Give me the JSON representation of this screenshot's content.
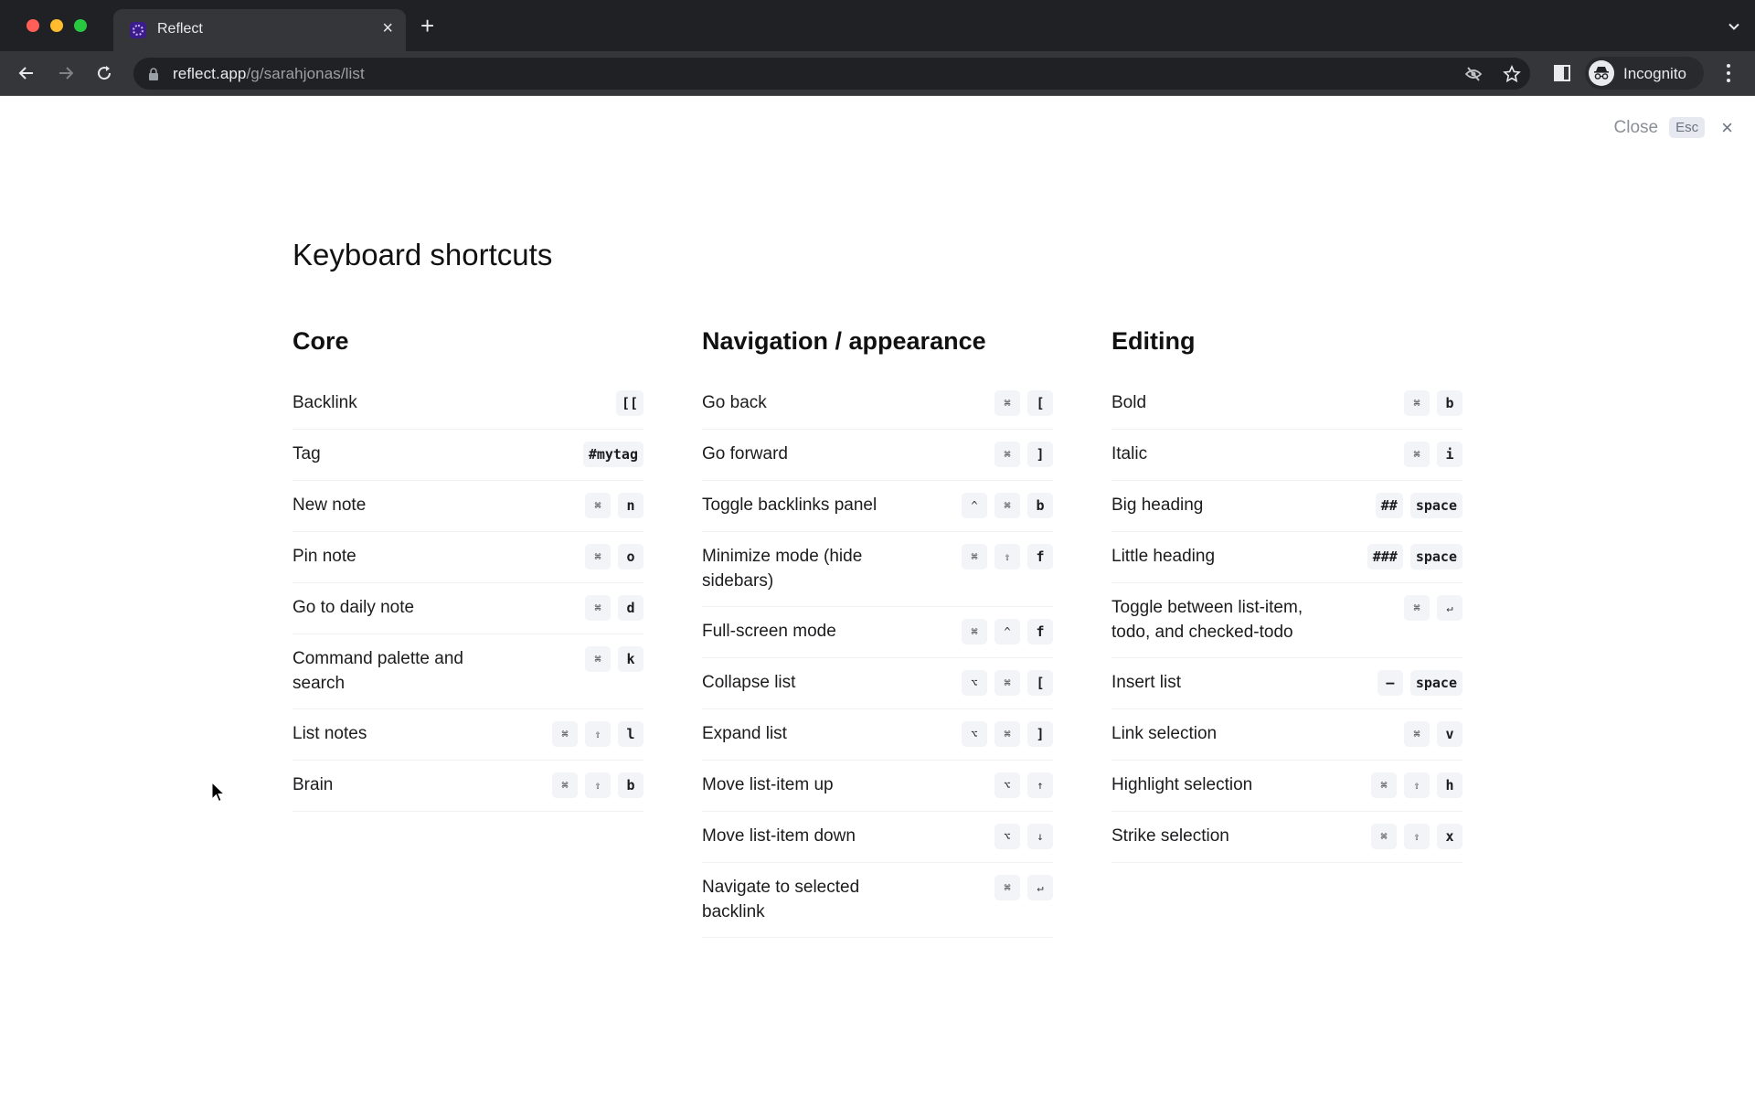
{
  "browser": {
    "tab_title": "Reflect",
    "url_host": "reflect.app",
    "url_path": "/g/sarahjonas/list",
    "profile_label": "Incognito",
    "icons": {
      "back": "arrow-left-icon",
      "forward": "arrow-right-icon",
      "reload": "reload-icon",
      "lock": "lock-icon",
      "tracking": "eye-slash-icon",
      "bookmark": "star-icon",
      "side_panel": "side-panel-icon",
      "incognito": "incognito-icon",
      "menu": "kebab-menu-icon",
      "tab_search": "chevron-down-icon"
    }
  },
  "modal": {
    "close_label": "Close",
    "close_key": "Esc",
    "close_icon": "×",
    "title": "Keyboard shortcuts"
  },
  "sections": [
    {
      "title": "Core",
      "items": [
        {
          "label": "Backlink",
          "keys": [
            "[["
          ]
        },
        {
          "label": "Tag",
          "keys": [
            "#mytag"
          ]
        },
        {
          "label": "New note",
          "keys": [
            "⌘",
            "n"
          ]
        },
        {
          "label": "Pin note",
          "keys": [
            "⌘",
            "o"
          ]
        },
        {
          "label": "Go to daily note",
          "keys": [
            "⌘",
            "d"
          ]
        },
        {
          "label": "Command palette and search",
          "keys": [
            "⌘",
            "k"
          ]
        },
        {
          "label": "List notes",
          "keys": [
            "⌘",
            "⇧",
            "l"
          ]
        },
        {
          "label": "Brain",
          "keys": [
            "⌘",
            "⇧",
            "b"
          ]
        }
      ]
    },
    {
      "title": "Navigation / appearance",
      "items": [
        {
          "label": "Go back",
          "keys": [
            "⌘",
            "["
          ]
        },
        {
          "label": "Go forward",
          "keys": [
            "⌘",
            "]"
          ]
        },
        {
          "label": "Toggle backlinks panel",
          "keys": [
            "^",
            "⌘",
            "b"
          ]
        },
        {
          "label": "Minimize mode (hide sidebars)",
          "keys": [
            "⌘",
            "⇧",
            "f"
          ]
        },
        {
          "label": "Full-screen mode",
          "keys": [
            "⌘",
            "^",
            "f"
          ]
        },
        {
          "label": "Collapse list",
          "keys": [
            "⌥",
            "⌘",
            "["
          ]
        },
        {
          "label": "Expand list",
          "keys": [
            "⌥",
            "⌘",
            "]"
          ]
        },
        {
          "label": "Move list-item up",
          "keys": [
            "⌥",
            "↑"
          ]
        },
        {
          "label": "Move list-item down",
          "keys": [
            "⌥",
            "↓"
          ]
        },
        {
          "label": "Navigate to selected backlink",
          "keys": [
            "⌘",
            "↵"
          ]
        }
      ]
    },
    {
      "title": "Editing",
      "items": [
        {
          "label": "Bold",
          "keys": [
            "⌘",
            "b"
          ]
        },
        {
          "label": "Italic",
          "keys": [
            "⌘",
            "i"
          ]
        },
        {
          "label": "Big heading",
          "keys": [
            "##",
            "space"
          ]
        },
        {
          "label": "Little heading",
          "keys": [
            "###",
            "space"
          ]
        },
        {
          "label": "Toggle between list-item, todo, and checked-todo",
          "keys": [
            "⌘",
            "↵"
          ]
        },
        {
          "label": "Insert list",
          "keys": [
            "–",
            "space"
          ]
        },
        {
          "label": "Link selection",
          "keys": [
            "⌘",
            "v"
          ]
        },
        {
          "label": "Highlight selection",
          "keys": [
            "⌘",
            "⇧",
            "h"
          ]
        },
        {
          "label": "Strike selection",
          "keys": [
            "⌘",
            "⇧",
            "x"
          ]
        }
      ]
    }
  ]
}
